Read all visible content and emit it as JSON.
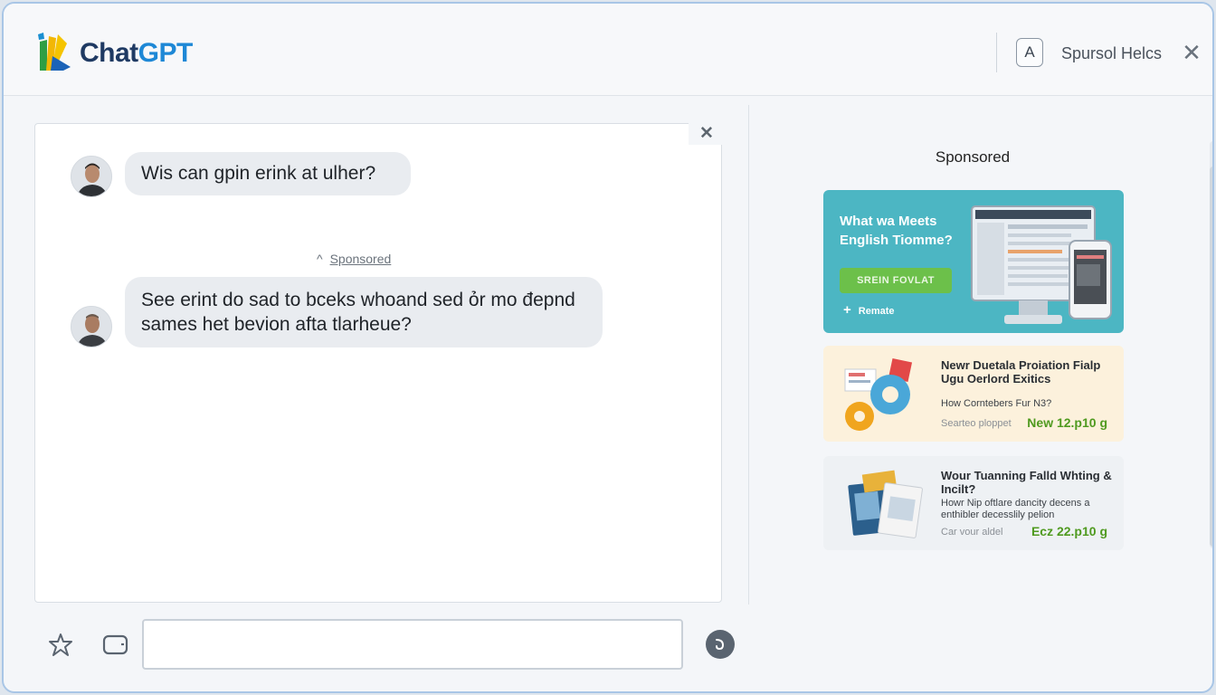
{
  "header": {
    "brand_part1": "Chat",
    "brand_part2": "GPT",
    "account_letter": "A",
    "help_link": "Spursol Helcs",
    "close_glyph": "✕"
  },
  "chat": {
    "close_glyph": "✕",
    "messages": [
      {
        "text": "Wis can gpin erink at ulher?"
      },
      {
        "line1": "See erint do sad to bceks whoand sed ỏr mo đepnd",
        "line2": "sames het bevion afta tlarheue?"
      }
    ],
    "sponsored_label": "Sponsored",
    "sponsored_glyph": "^"
  },
  "sidebar": {
    "title": "Sponsored",
    "ads": [
      {
        "headline": "What wa Meets English Tiomme?",
        "button_label": "SREIN FOVLAT",
        "footer": "Remate"
      },
      {
        "headline": "Newr Duetala Proiation Fialp Ugu Oerlord Exitics",
        "description": "How Corntebers Fur N3?",
        "sponsor": "Searteo ploppet",
        "price": "New 12.p10 g"
      },
      {
        "headline": "Wour Tuanning Falld Whting & Incilt?",
        "description": "Howr Nip oftlare dancity decens a enthibler decesslily pelion",
        "sponsor": "Car vour aldel",
        "price": "Ecz 22.p10 g"
      }
    ]
  },
  "composer": {
    "input_value": "",
    "input_placeholder": ""
  },
  "colors": {
    "accent_blue": "#1e88d6",
    "brand_navy": "#1f3a63",
    "ad_teal": "#4cb6c3",
    "price_green": "#4f9a1f",
    "bubble_gray": "#e9ecf0"
  },
  "icons": {
    "logo": "chatgpt-logo",
    "attach": "sparkle-tool-icon",
    "message": "speech-tool-icon",
    "send": "send-icon"
  }
}
